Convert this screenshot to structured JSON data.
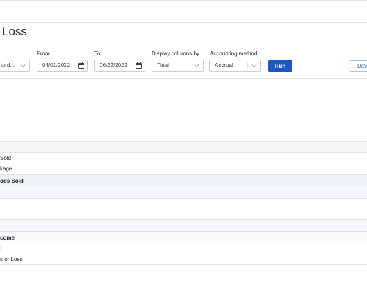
{
  "report": {
    "title": "Loss",
    "date_range_value": "to d..."
  },
  "filters": {
    "from": {
      "label": "From",
      "value": "04/01/2022"
    },
    "to": {
      "label": "To",
      "value": "06/22/2022"
    },
    "display_columns": {
      "label": "Display columns by",
      "value": "Total"
    },
    "accounting_method": {
      "label": "Accounting method",
      "value": "Accrual"
    }
  },
  "actions": {
    "run_label": "Run",
    "download_label": "Dow"
  },
  "rows": {
    "cogs_line1": "Sold",
    "cogs_line2": "kage",
    "cogs_total": "ods Sold",
    "net_income": "come",
    "net_line1": ":",
    "net_line2": "s or Loss"
  }
}
